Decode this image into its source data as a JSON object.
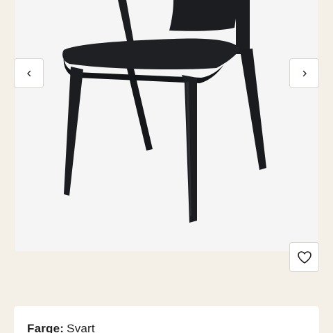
{
  "gallery": {
    "image": "product-chair-photo",
    "chair_color": "#1c1d20",
    "background_color": "#f5f5f5",
    "prev_icon": "chevron-left-icon",
    "next_icon": "chevron-right-icon",
    "favorite_icon": "heart-outline-icon"
  },
  "product_info": {
    "color_label": "Farge:",
    "color_value": "Svart"
  },
  "colors": {
    "page_bg": "#f4efe7",
    "card_bg": "#ffffff",
    "text": "#1f1f1f"
  }
}
